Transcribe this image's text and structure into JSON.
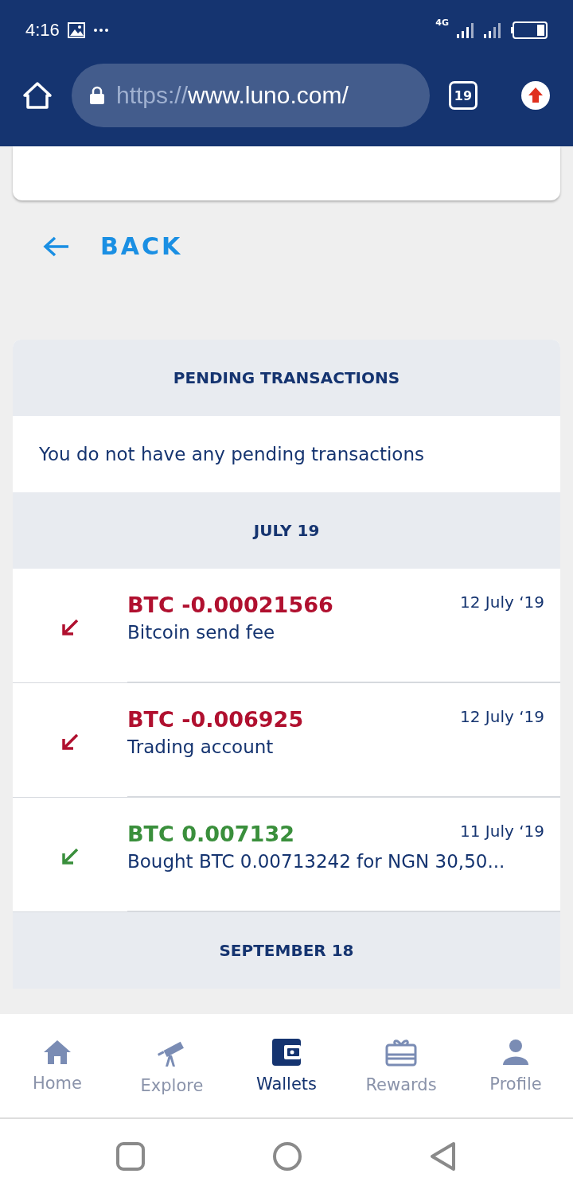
{
  "status_bar": {
    "time": "4:16",
    "network": "4G"
  },
  "browser": {
    "url_scheme": "https://",
    "url_host": "www.luno.com/",
    "tab_count": "19"
  },
  "back": {
    "label": "BACK"
  },
  "pending": {
    "title": "PENDING TRANSACTIONS",
    "message": "You do not have any pending transactions"
  },
  "groups": [
    {
      "title": "JULY 19",
      "transactions": [
        {
          "kind": "debit",
          "amount": "BTC -0.00021566",
          "description": "Bitcoin send fee",
          "date": "12 July ‘19"
        },
        {
          "kind": "debit",
          "amount": "BTC -0.006925",
          "description": "Trading account",
          "date": "12 July ‘19"
        },
        {
          "kind": "credit",
          "amount": "BTC 0.007132",
          "description": "Bought BTC 0.00713242 for NGN 30,50...",
          "date": "11 July ‘19"
        }
      ]
    },
    {
      "title": "SEPTEMBER 18"
    }
  ],
  "nav": [
    {
      "label": "Home",
      "kind": "home",
      "selected": false
    },
    {
      "label": "Explore",
      "kind": "telescope",
      "selected": false
    },
    {
      "label": "Wallets",
      "kind": "wallet",
      "selected": true
    },
    {
      "label": "Rewards",
      "kind": "gift",
      "selected": false
    },
    {
      "label": "Profile",
      "kind": "person",
      "selected": false
    }
  ]
}
